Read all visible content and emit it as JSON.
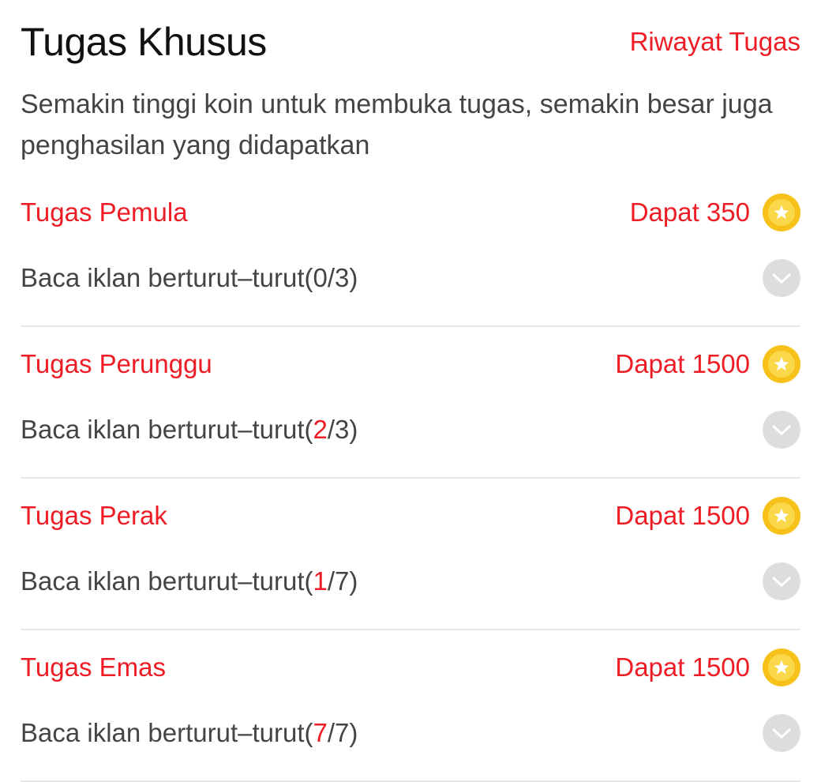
{
  "header": {
    "title": "Tugas Khusus",
    "history_link": "Riwayat Tugas"
  },
  "subtitle": "Semakin tinggi koin untuk membuka tugas, semakin besar juga penghasilan yang didapatkan",
  "colors": {
    "accent": "#ee1c25",
    "coin": "#f6c21a",
    "check_bg": "#dddddd"
  },
  "icons": {
    "coin": "star-coin-icon",
    "status": "check-circle-icon"
  },
  "tasks": [
    {
      "name": "Tugas Pemula",
      "reward": "Dapat 350",
      "desc_prefix": "Baca iklan berturut–turut(",
      "done": "0",
      "done_highlight": false,
      "total": "/3)"
    },
    {
      "name": "Tugas Perunggu",
      "reward": "Dapat 1500",
      "desc_prefix": "Baca iklan berturut–turut(",
      "done": "2",
      "done_highlight": true,
      "total": "/3)"
    },
    {
      "name": "Tugas Perak",
      "reward": "Dapat 1500",
      "desc_prefix": "Baca iklan berturut–turut(",
      "done": "1",
      "done_highlight": true,
      "total": "/7)"
    },
    {
      "name": "Tugas Emas",
      "reward": "Dapat 1500",
      "desc_prefix": "Baca iklan berturut–turut(",
      "done": "7",
      "done_highlight": true,
      "total": "/7)"
    }
  ]
}
